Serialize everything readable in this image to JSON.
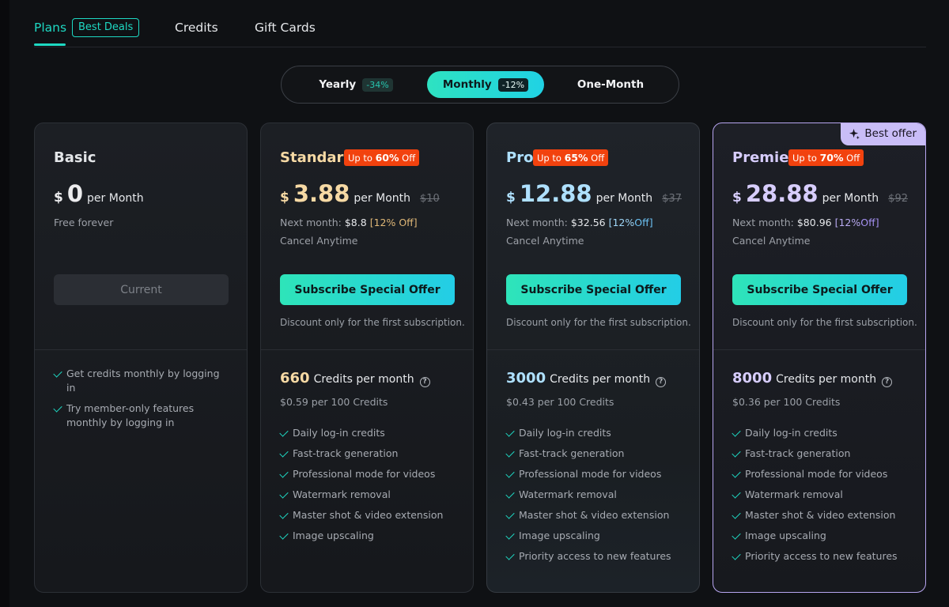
{
  "nav": {
    "tabs": [
      {
        "label": "Plans",
        "active": true
      },
      {
        "label": "Credits",
        "active": false
      },
      {
        "label": "Gift Cards",
        "active": false
      }
    ],
    "plans_badge": "Best Deals"
  },
  "billing": {
    "yearly": {
      "label": "Yearly",
      "discount": "-34%"
    },
    "monthly": {
      "label": "Monthly",
      "discount": "-12%",
      "selected": true
    },
    "one_month": {
      "label": "One-Month"
    }
  },
  "currency": "$",
  "per_month": "per Month",
  "next_month_label": "Next month:",
  "cancel_text": "Cancel Anytime",
  "subscribe_label": "Subscribe Special Offer",
  "discount_note": "Discount only for the first subscription.",
  "credits_per_month_label": "Credits per month",
  "best_offer_label": "Best offer",
  "badge_prefix": "Up to",
  "badge_suffix": "Off",
  "plans": {
    "basic": {
      "name": "Basic",
      "price": "0",
      "subtitle": "Free forever",
      "button": "Current",
      "features": [
        "Get credits monthly by logging in",
        "Try member-only features monthly by logging in"
      ]
    },
    "standard": {
      "name": "Standard",
      "badge_pct": "60%",
      "price": "3.88",
      "old_price": "$10",
      "next_price": "$8.8",
      "next_off": "[12% Off]",
      "credits": "660",
      "per100": "$0.59 per 100 Credits",
      "features": [
        "Daily log-in credits",
        "Fast-track generation",
        "Professional mode for videos",
        "Watermark removal",
        "Master shot & video extension",
        "Image upscaling"
      ]
    },
    "pro": {
      "name": "Pro",
      "badge_pct": "65%",
      "price": "12.88",
      "old_price": "$37",
      "next_price": "$32.56",
      "next_off_pct": "[12%",
      "next_off_word": "Off]",
      "credits": "3000",
      "per100": "$0.43 per 100 Credits",
      "features": [
        "Daily log-in credits",
        "Fast-track generation",
        "Professional mode for videos",
        "Watermark removal",
        "Master shot & video extension",
        "Image upscaling",
        "Priority access to new features"
      ]
    },
    "premier": {
      "name": "Premier",
      "badge_pct": "70%",
      "price": "28.88",
      "old_price": "$92",
      "next_price": "$80.96",
      "next_off_pct": "[12%",
      "next_off_word": "Off]",
      "credits": "8000",
      "per100": "$0.36 per 100 Credits",
      "features": [
        "Daily log-in credits",
        "Fast-track generation",
        "Professional mode for videos",
        "Watermark removal",
        "Master shot & video extension",
        "Image upscaling",
        "Priority access to new features"
      ]
    }
  },
  "colors": {
    "accent": "#1ed9c3",
    "badge_red": "#f2420e",
    "standard_gold": "#f6d9a4",
    "pro_blue": "#aee0ff",
    "premier_violet": "#d7cdfd",
    "best_offer_bg": "#c9bdf7"
  }
}
